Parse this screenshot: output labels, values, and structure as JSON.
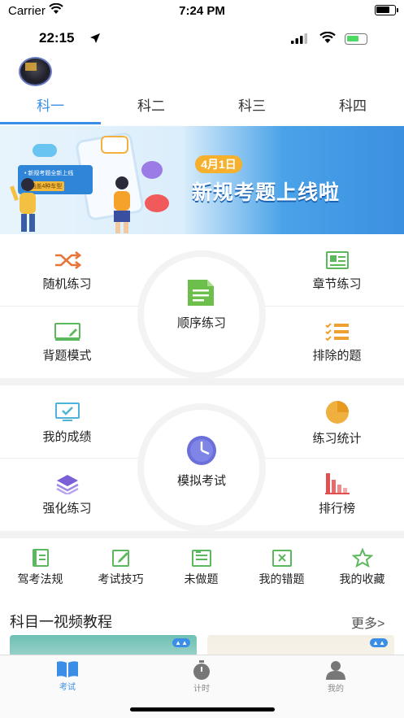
{
  "status_bar_outer": {
    "carrier": "Carrier",
    "time": "7:24 PM"
  },
  "status_bar_inner": {
    "time": "22:15"
  },
  "subjects": [
    "科一",
    "科二",
    "科三",
    "科四"
  ],
  "active_subject": 0,
  "banner": {
    "date": "4月1日",
    "headline": "新规考题上线啦",
    "card_line1": "• 新规考题全新上线",
    "card_line2": "• 涵盖4种车型"
  },
  "features_top": {
    "random": "随机练习",
    "chapter": "章节练习",
    "sequential": "顺序练习",
    "memorize": "背题模式",
    "excluded": "排除的题"
  },
  "features_bottom": {
    "scores": "我的成绩",
    "stats": "练习统计",
    "mock": "模拟考试",
    "intensive": "强化练习",
    "ranking": "排行榜"
  },
  "mini_row": [
    "驾考法规",
    "考试技巧",
    "未做题",
    "我的错题",
    "我的收藏"
  ],
  "video": {
    "title": "科目一视频教程",
    "more": "更多>"
  },
  "tabbar": [
    "考试",
    "计时",
    "我的"
  ],
  "colors": {
    "accent": "#3a8ee6",
    "green": "#5cb85c",
    "orange": "#f0a030",
    "purple": "#7a5fd6",
    "red": "#e05050"
  }
}
